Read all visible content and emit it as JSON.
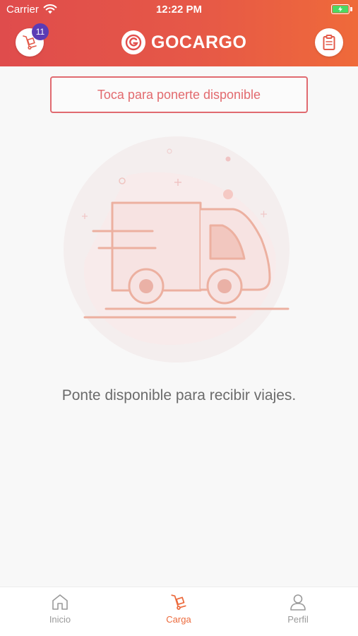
{
  "status_bar": {
    "carrier": "Carrier",
    "time": "12:22 PM"
  },
  "header": {
    "logo_text": "GOCARGO",
    "cargo_badge_count": "11"
  },
  "availability_button": {
    "label": "Toca para ponerte disponible"
  },
  "main": {
    "message": "Ponte disponible para recibir viajes."
  },
  "tabbar": {
    "tabs": [
      {
        "label": "Inicio",
        "icon": "home-icon",
        "active": false
      },
      {
        "label": "Carga",
        "icon": "trolley-icon",
        "active": true
      },
      {
        "label": "Perfil",
        "icon": "user-icon",
        "active": false
      }
    ]
  },
  "colors": {
    "header_gradient_start": "#df4c4c",
    "header_gradient_end": "#ef6a3a",
    "accent": "#e26a6e",
    "active_tab": "#ec6a3c",
    "badge": "#5b3bb5",
    "illustration": "#ecb0a0"
  }
}
